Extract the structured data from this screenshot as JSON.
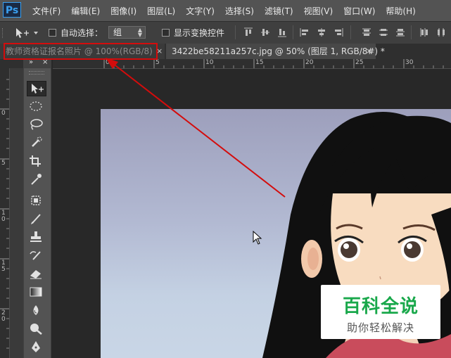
{
  "app": {
    "logo_text": "Ps"
  },
  "menubar": {
    "items": [
      "文件(F)",
      "编辑(E)",
      "图像(I)",
      "图层(L)",
      "文字(Y)",
      "选择(S)",
      "滤镜(T)",
      "视图(V)",
      "窗口(W)",
      "帮助(H)"
    ]
  },
  "options": {
    "auto_select_label": "自动选择：",
    "auto_select_value": "组",
    "show_transform_label": "显示变换控件"
  },
  "tabs": [
    {
      "label": "教师资格证报名照片 @ 100%(RGB/8)",
      "close": "×",
      "active": false
    },
    {
      "label": "3422be58211a257c.jpg @ 50% (图层 1, RGB/8#) *",
      "close": "×",
      "active": true
    }
  ],
  "ruler": {
    "top_labels": [
      "0",
      "5",
      "10",
      "15",
      "20",
      "25",
      "30"
    ],
    "left_labels": [
      "0",
      "5",
      "1\n0",
      "1\n5",
      "2\n0"
    ]
  },
  "toolbar": {
    "collapse_glyph": "»",
    "close_glyph": "×",
    "tools": [
      "move-tool",
      "marquee-tool",
      "lasso-tool",
      "quick-select-tool",
      "crop-tool",
      "eyedropper-tool",
      "healing-brush-tool",
      "brush-tool",
      "clone-stamp-tool",
      "history-brush-tool",
      "eraser-tool",
      "gradient-tool",
      "blur-tool",
      "dodge-tool",
      "pen-tool"
    ]
  },
  "watermark": {
    "title": "百科全说",
    "subtitle": "助你轻松解决"
  },
  "colors": {
    "annotation_red": "#d40c0c",
    "brand_blue": "#3aa0f0",
    "watermark_green": "#19a84b"
  }
}
